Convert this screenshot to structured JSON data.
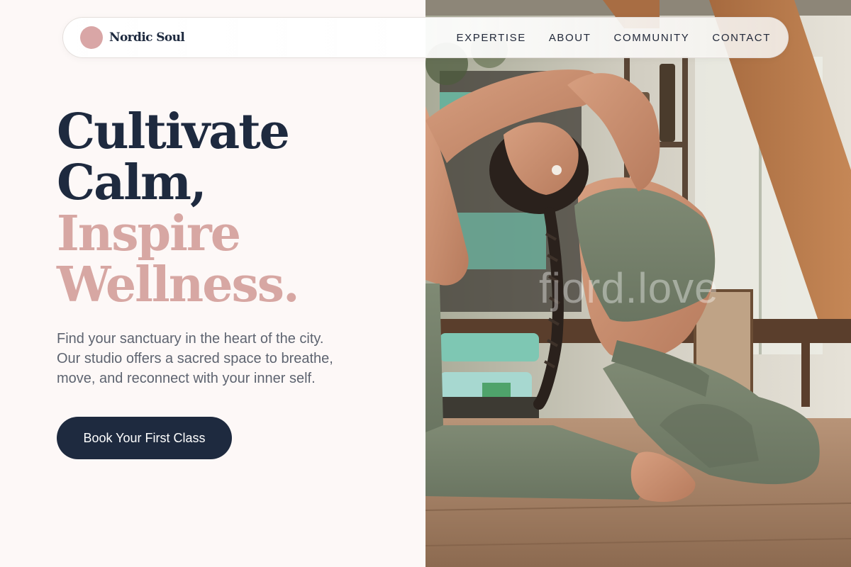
{
  "brand": {
    "name": "Nordic Soul",
    "logo_icon": "circle-logo-icon"
  },
  "nav": {
    "items": [
      {
        "label": "EXPERTISE"
      },
      {
        "label": "ABOUT"
      },
      {
        "label": "COMMUNITY"
      },
      {
        "label": "CONTACT"
      }
    ]
  },
  "hero": {
    "headline": {
      "line1": "Cultivate",
      "line2": "Calm,",
      "line3": "Inspire",
      "line4": "Wellness."
    },
    "subtext": {
      "line1": "Find your sanctuary in the heart of the city.",
      "line2": "Our studio offers a sacred space to breathe,",
      "line3": "move, and reconnect with your inner self."
    },
    "cta_label": "Book Your First Class",
    "image_watermark": "fjord.love"
  },
  "colors": {
    "navy": "#1e2a3f",
    "accent_pink": "#d7a7a3",
    "background": "#fdf8f7",
    "body_text": "#5e6470"
  }
}
